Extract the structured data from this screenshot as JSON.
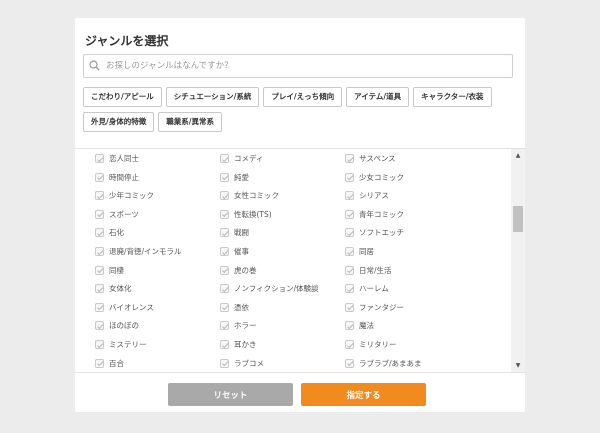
{
  "dialog": {
    "title": "ジャンルを選択"
  },
  "search": {
    "placeholder": "お探しのジャンルはなんですか？"
  },
  "categories": [
    "こだわり/アピール",
    "シチュエーション/系統",
    "プレイ/えっち傾向",
    "アイテム/道具",
    "キャラクター/衣装",
    "外見/身体的特徴",
    "職業系/異常系"
  ],
  "genres": [
    [
      "恋人同士",
      "コメディ",
      "サスペンス"
    ],
    [
      "時間停止",
      "純愛",
      "少女コミック"
    ],
    [
      "少年コミック",
      "女性コミック",
      "シリアス"
    ],
    [
      "スポーツ",
      "性転換(TS)",
      "青年コミック"
    ],
    [
      "石化",
      "戦闘",
      "ソフトエッチ"
    ],
    [
      "退廃/背徳/インモラル",
      "催事",
      "同居"
    ],
    [
      "同棲",
      "虎の巻",
      "日常/生活"
    ],
    [
      "女体化",
      "ノンフィクション/体験談",
      "ハーレム"
    ],
    [
      "バイオレンス",
      "憑依",
      "ファンタジー"
    ],
    [
      "ほのぼの",
      "ホラー",
      "魔法"
    ],
    [
      "ミステリー",
      "耳かき",
      "ミリタリー"
    ],
    [
      "百合",
      "ラブコメ",
      "ラブラブ/あまあま"
    ]
  ],
  "footer": {
    "reset_label": "リセット",
    "apply_label": "指定する"
  },
  "colors": {
    "accent": "#f28b1e",
    "reset": "#a9a9a9",
    "background": "#ececec"
  }
}
